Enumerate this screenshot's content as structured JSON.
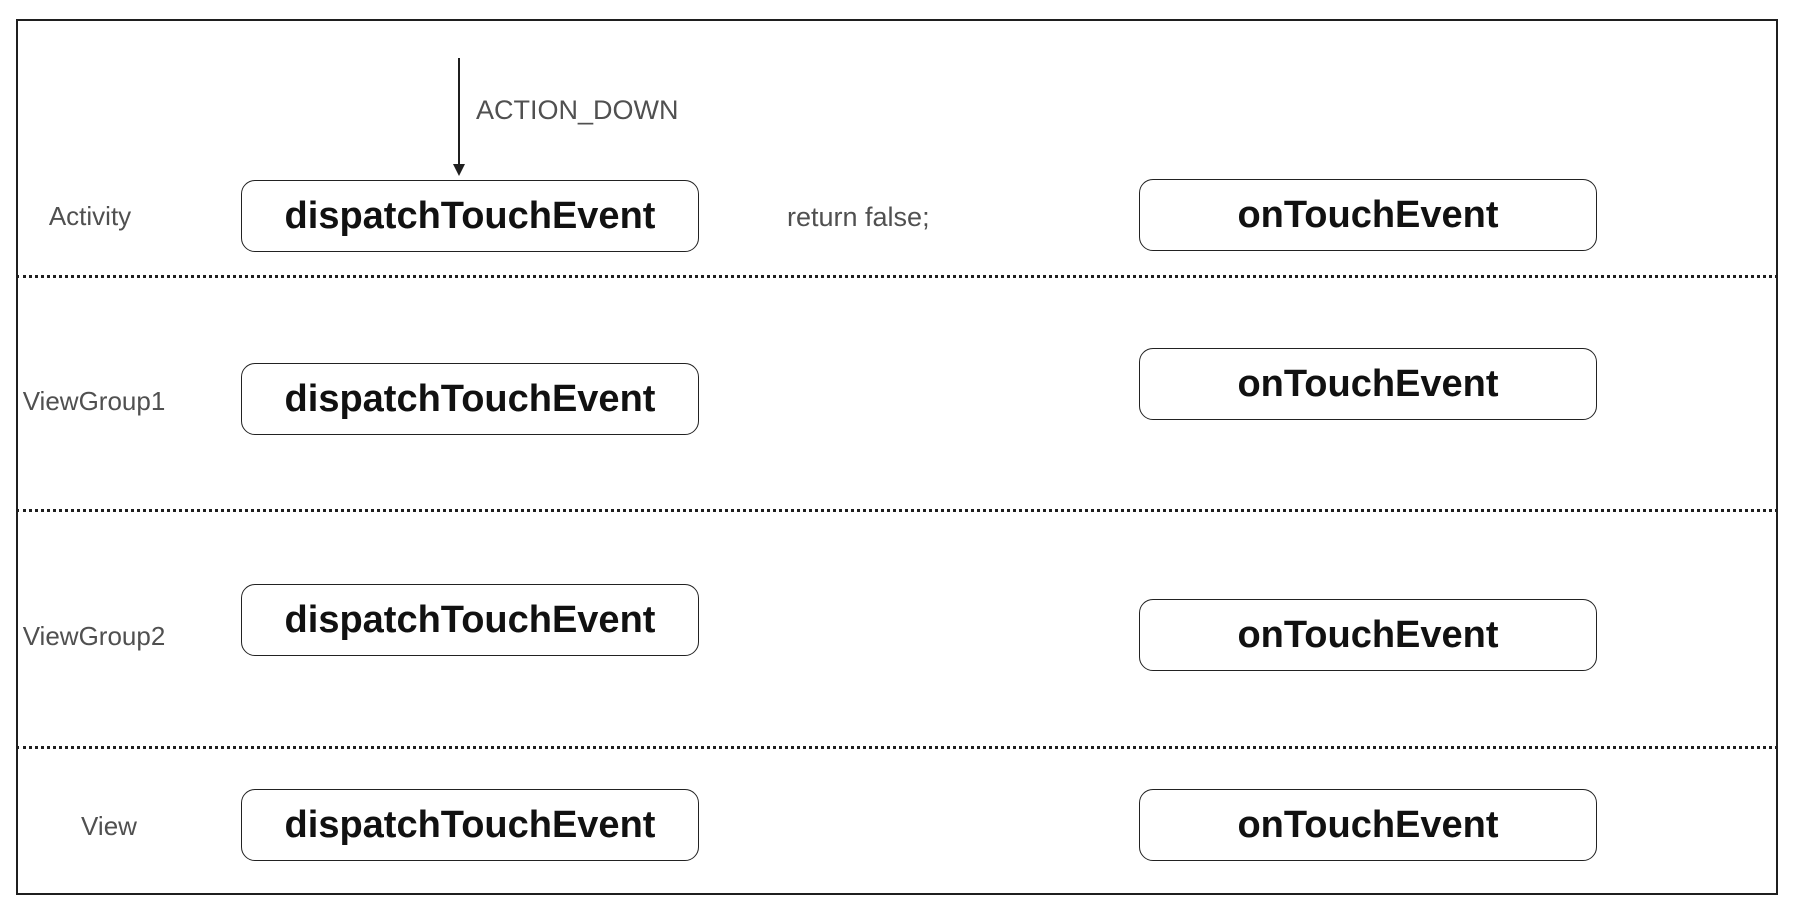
{
  "rows": [
    {
      "layer": "Activity",
      "dispatch": "dispatchTouchEvent",
      "ontouch": "onTouchEvent"
    },
    {
      "layer": "ViewGroup1",
      "dispatch": "dispatchTouchEvent",
      "ontouch": "onTouchEvent"
    },
    {
      "layer": "ViewGroup2",
      "dispatch": "dispatchTouchEvent",
      "ontouch": "onTouchEvent"
    },
    {
      "layer": "View",
      "dispatch": "dispatchTouchEvent",
      "ontouch": "onTouchEvent"
    }
  ],
  "annotations": {
    "entry_event": "ACTION_DOWN",
    "activity_return": "return false;"
  }
}
